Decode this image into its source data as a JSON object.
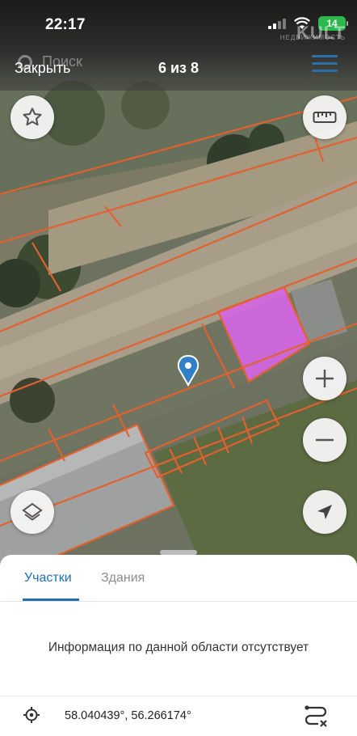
{
  "status_bar": {
    "time": "22:17",
    "battery": "14"
  },
  "watermark": {
    "text": "KULT",
    "sub": "НЕДВИЖИМОСТЬ"
  },
  "map_header": {
    "search_placeholder": "Поиск"
  },
  "viewer": {
    "close_label": "Закрыть",
    "counter": "6 из 8"
  },
  "map": {
    "selected_parcel_color": "#d566e6",
    "boundary_color": "#e2612f",
    "marker_color": "#2f80c8"
  },
  "sheet": {
    "tabs": [
      {
        "label": "Участки",
        "active": true
      },
      {
        "label": "Здания",
        "active": false
      }
    ],
    "info": "Информация по данной области отсутствует",
    "coordinates": "58.040439°, 56.266174°"
  },
  "icons": [
    "star-icon",
    "ruler-icon",
    "zoom-in-icon",
    "zoom-out-icon",
    "layers-icon",
    "locate-arrow-icon",
    "crosshair-icon",
    "route-icon",
    "menu-icon",
    "map-marker-icon"
  ]
}
